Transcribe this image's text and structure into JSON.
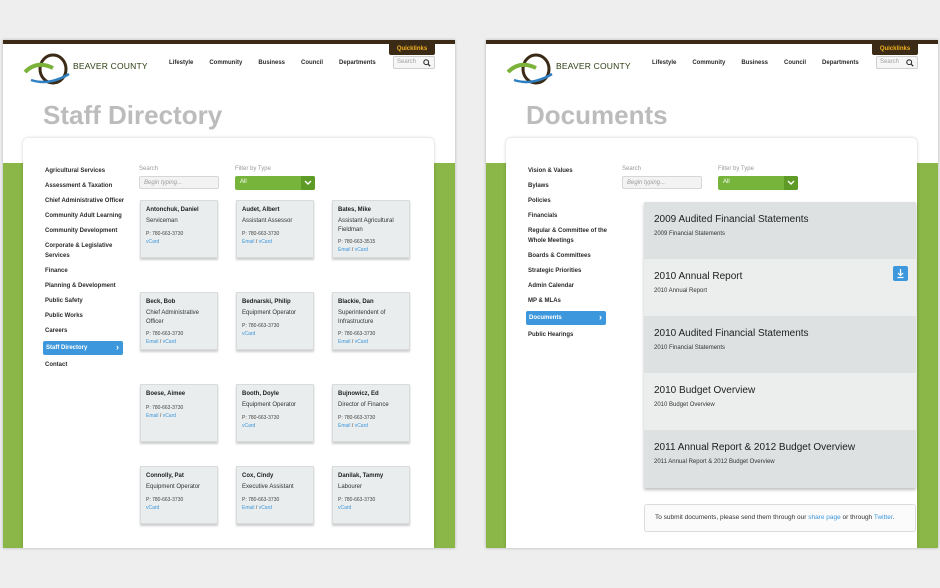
{
  "brand": "BEAVER COUNTY",
  "quicklinks": "Quicklinks",
  "nav": [
    "Lifestyle",
    "Community",
    "Business",
    "Council",
    "Departments"
  ],
  "search_placeholder": "Search",
  "colors": {
    "accent": "#3d97dc",
    "green": "#8ab748",
    "brown": "#3b2a15"
  },
  "left": {
    "title": "Staff Directory",
    "sidebar": [
      "Agricultural Services",
      "Assessment & Taxation",
      "Chief Administrative Officer",
      "Community Adult Learning",
      "Community Development",
      "Corporate & Legislative Services",
      "Finance",
      "Planning & Development",
      "Public Safety",
      "Public Works",
      "Careers",
      "Staff Directory",
      "Contact"
    ],
    "active_index": 11,
    "search_label": "Search",
    "search_placeholder": "Begin typing...",
    "filter_label": "Filter by Type",
    "filter_value": "All",
    "phone": "P: 780-663-3730",
    "email": "Email",
    "vcard": "vCard",
    "sep": "/",
    "staff": [
      {
        "name": "Antonchuk, Daniel",
        "title": "Serviceman",
        "phone": "P: 780-663-3730",
        "links": "vcard"
      },
      {
        "name": "Audet, Albert",
        "title": "Assistant Assessor",
        "phone": "P: 780-663-3730",
        "links": "both"
      },
      {
        "name": "Bates, Mike",
        "title": "Assistant Agricultural Fieldman",
        "phone": "P: 780-663-3515",
        "links": "both"
      },
      {
        "name": "Beck, Bob",
        "title": "Chief Administrative Officer",
        "phone": "P: 780-663-3730",
        "links": "both"
      },
      {
        "name": "Bednarski, Philip",
        "title": "Equipment Operator",
        "phone": "P: 780-663-3730",
        "links": "vcard"
      },
      {
        "name": "Blackie, Dan",
        "title": "Superintendent of Infrastructure",
        "phone": "P: 780-663-3730",
        "links": "both"
      },
      {
        "name": "Boese, Aimee",
        "title": "",
        "phone": "P: 780-663-3730",
        "links": "both"
      },
      {
        "name": "Booth, Doyle",
        "title": "Equipment Operator",
        "phone": "P: 780-663-3730",
        "links": "vcard"
      },
      {
        "name": "Bujnowicz, Ed",
        "title": "Director of Finance",
        "phone": "P: 780-663-3730",
        "links": "both"
      },
      {
        "name": "Connolly, Pat",
        "title": "Equipment Operator",
        "phone": "P: 780-663-3730",
        "links": "vcard"
      },
      {
        "name": "Cox, Cindy",
        "title": "Executive Assistant",
        "phone": "P: 780-663-3730",
        "links": "both"
      },
      {
        "name": "Danilak, Tammy",
        "title": "Labourer",
        "phone": "P: 780-663-3730",
        "links": "vcard"
      }
    ]
  },
  "right": {
    "title": "Documents",
    "sidebar": [
      "Vision & Values",
      "Bylaws",
      "Policies",
      "Financials",
      "Regular & Committee of the Whole Meetings",
      "Boards & Committees",
      "Strategic Priorities",
      "Admin Calendar",
      "MP & MLAs",
      "Documents",
      "Public Hearings"
    ],
    "active_index": 9,
    "search_label": "Search",
    "search_placeholder": "Begin typing...",
    "filter_label": "Filter by Type",
    "filter_value": "All",
    "documents": [
      {
        "title": "2009 Audited Financial Statements",
        "type": "2009 Financial Statements"
      },
      {
        "title": "2010 Annual Report",
        "type": "2010 Annual Report",
        "download": true
      },
      {
        "title": "2010 Audited Financial Statements",
        "type": "2010 Financial Statements"
      },
      {
        "title": "2010 Budget Overview",
        "type": "2010 Budget Overview"
      },
      {
        "title": "2011 Annual Report & 2012 Budget Overview",
        "type": "2011 Annual Report & 2012 Budget Overview"
      }
    ],
    "submit": {
      "pre": "To submit documents, please send them through our ",
      "link1": "share page",
      "mid": " or through ",
      "link2": "Twitter",
      "post": "."
    }
  }
}
